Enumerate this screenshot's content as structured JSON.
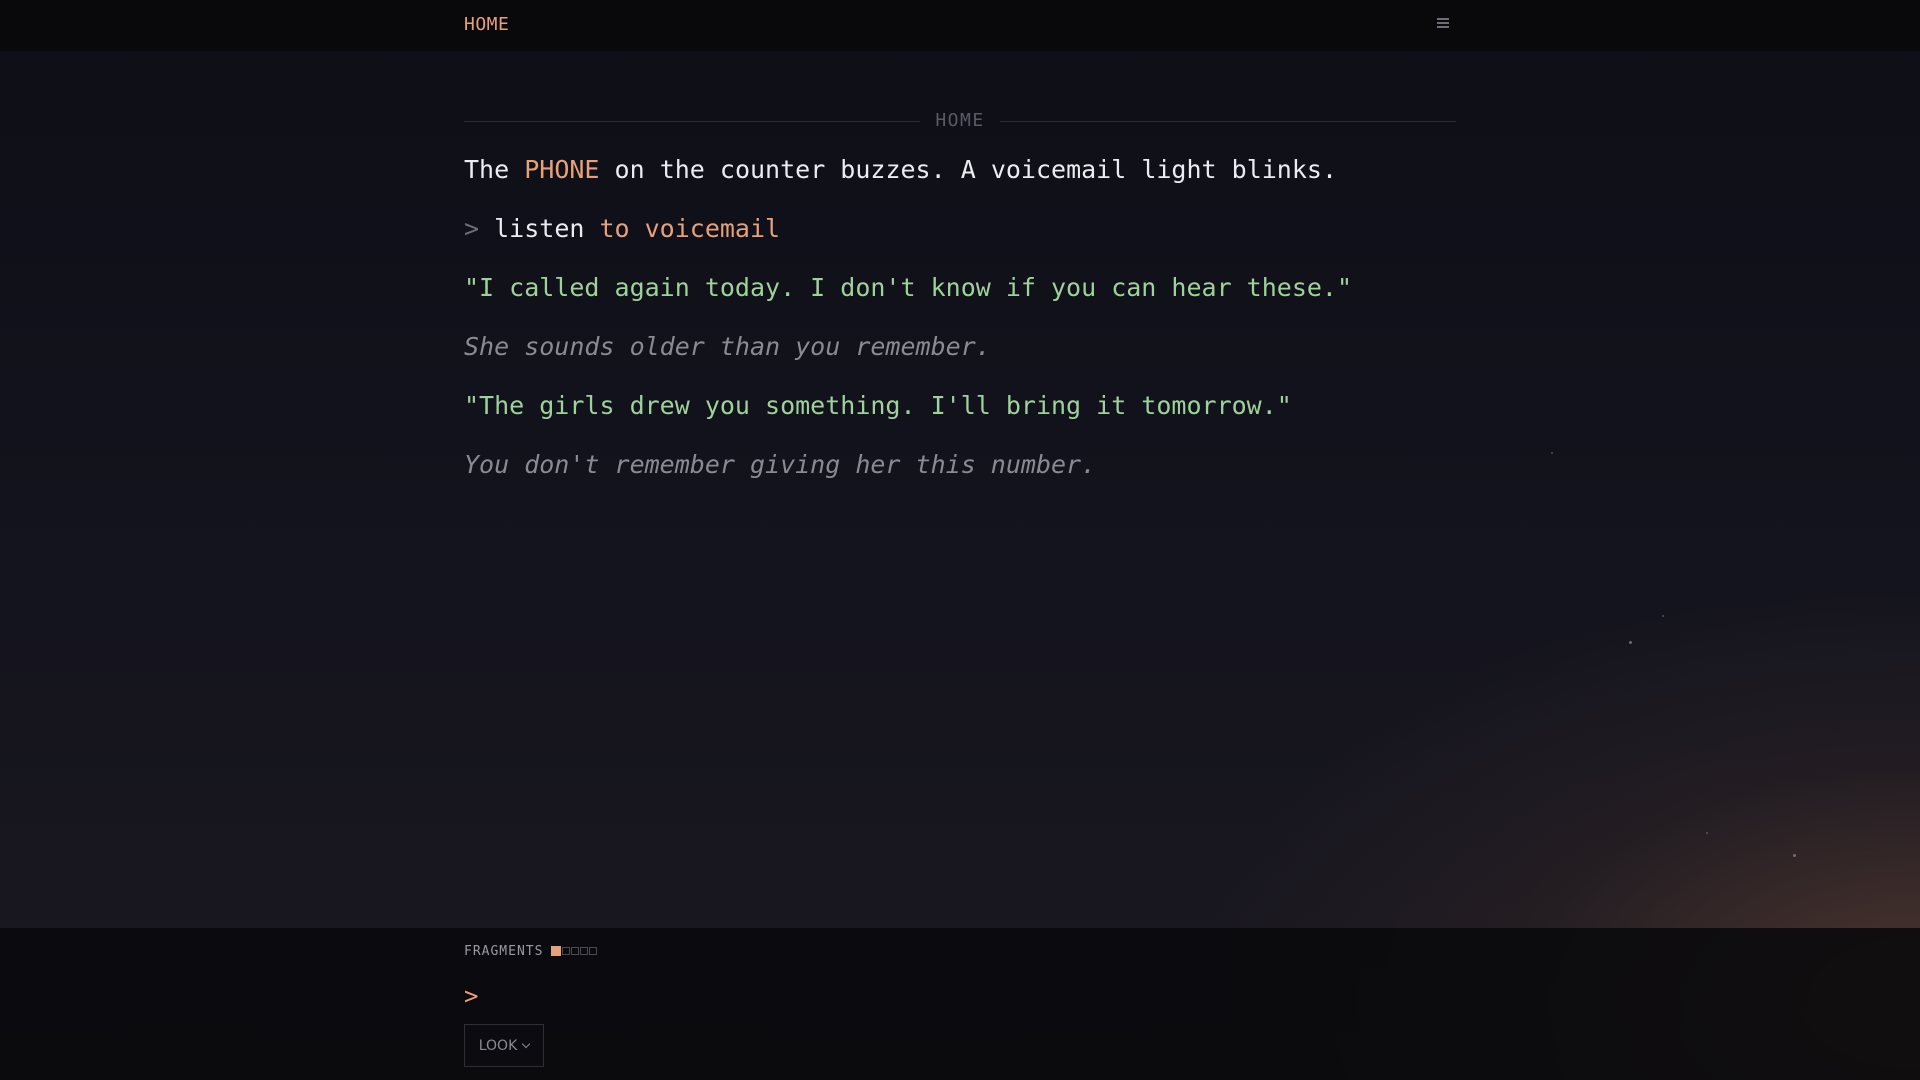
{
  "topbar": {
    "location": "HOME",
    "menu_icon": "hamburger-menu-icon"
  },
  "section": {
    "label": "HOME"
  },
  "story": {
    "p1": {
      "before": "The ",
      "highlight": "PHONE",
      "after": " on the counter buzzes. A voicemail light blinks."
    },
    "p2": {
      "prompt": "> ",
      "verb": "listen ",
      "object": "to voicemail"
    },
    "p3": "\"I called again today. I don't know if you can hear these.\"",
    "p4": "She sounds older than you remember.",
    "p5": "\"The girls drew you something. I'll bring it tomorrow.\"",
    "p6": "You don't remember giving her this number."
  },
  "fragments": {
    "label": "FRAGMENTS",
    "collected": 1,
    "total": 5
  },
  "input": {
    "prompt": ">",
    "value": ""
  },
  "look_button": {
    "label": "LOOK",
    "icon": "chevron-down-icon"
  },
  "colors": {
    "accent": "#e6a07a",
    "dialogue": "#9ed29a",
    "narration": "#8a8a94",
    "text": "#ececf0"
  }
}
